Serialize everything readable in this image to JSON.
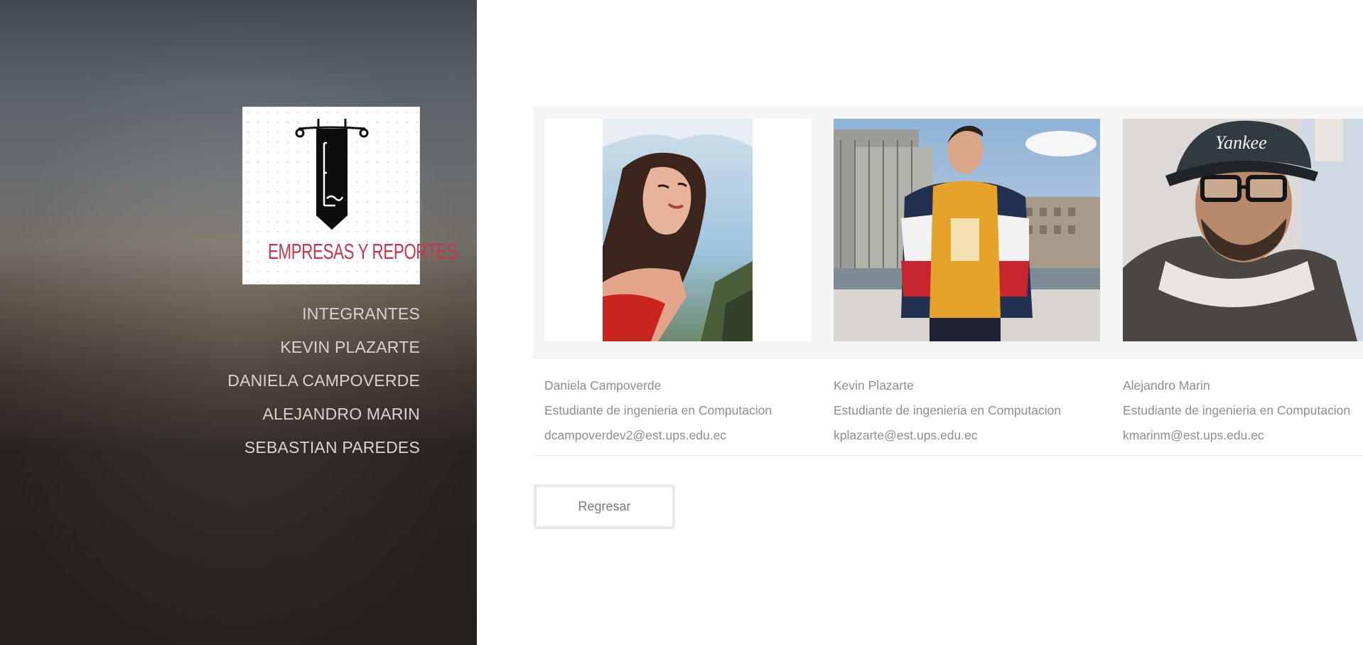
{
  "logo": {
    "text": "EMPRESAS Y REPORTES",
    "icon": "pennant-banner-icon",
    "brand_color": "#c8354a"
  },
  "nav": {
    "items": [
      {
        "label": "INTEGRANTES"
      },
      {
        "label": "KEVIN PLAZARTE"
      },
      {
        "label": "DANIELA CAMPOVERDE"
      },
      {
        "label": "ALEJANDRO MARIN"
      },
      {
        "label": "SEBASTIAN PAREDES"
      }
    ]
  },
  "members": [
    {
      "name": "Daniela Campoverde",
      "role": "Estudiante de ingenieria en Computacion",
      "email": "dcampoverdev2@est.ups.edu.ec"
    },
    {
      "name": "Kevin Plazarte",
      "role": "Estudiante de ingenieria en Computacion",
      "email": "kplazarte@est.ups.edu.ec"
    },
    {
      "name": "Alejandro Marin",
      "role": "Estudiante de ingenieria en Computacion",
      "email": "kmarinm@est.ups.edu.ec"
    }
  ],
  "buttons": {
    "back_label": "Regresar"
  }
}
